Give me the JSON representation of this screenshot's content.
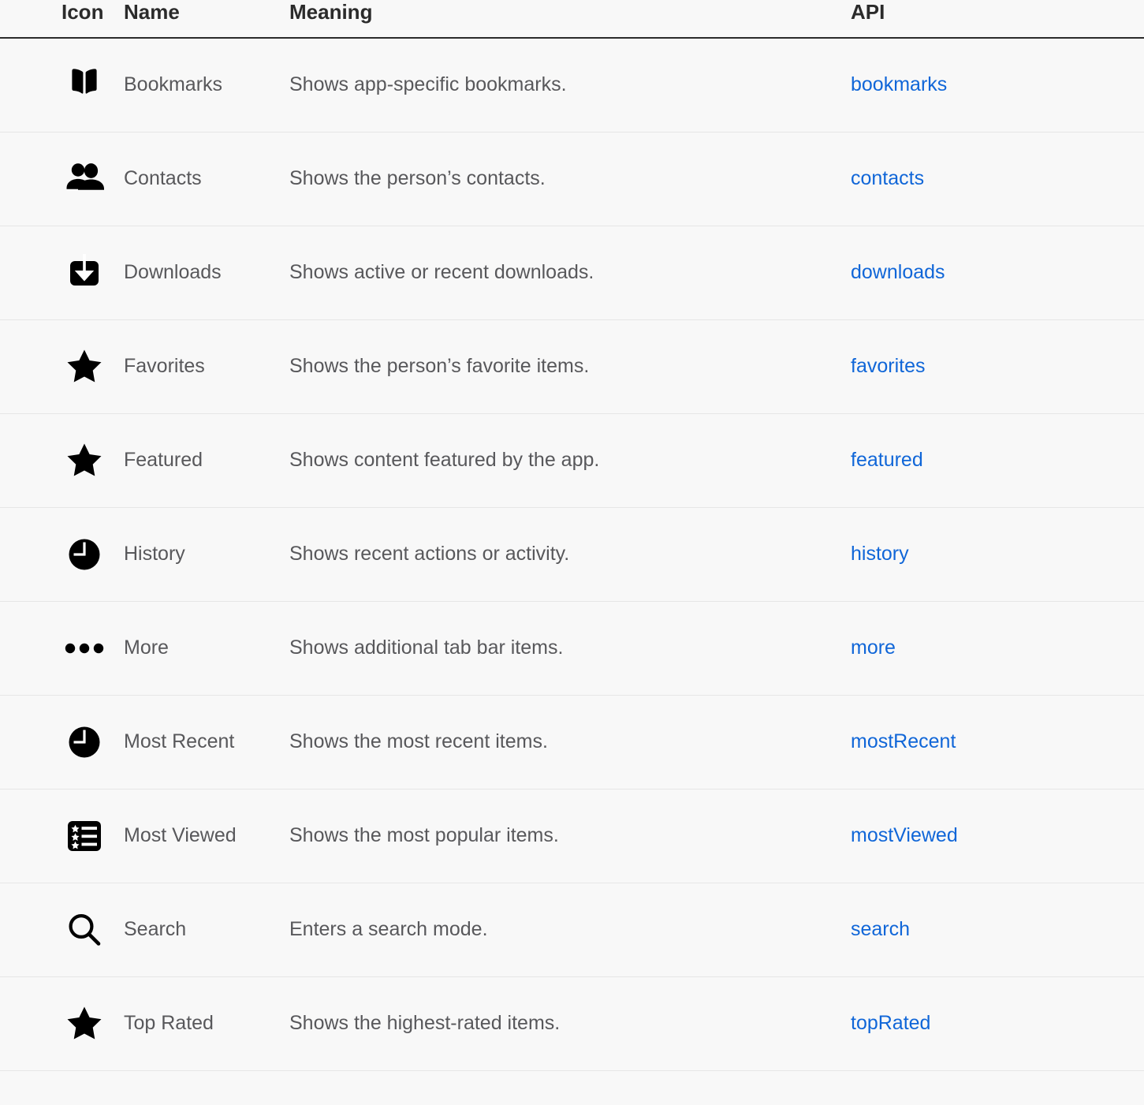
{
  "table": {
    "headers": {
      "icon": "Icon",
      "name": "Name",
      "meaning": "Meaning",
      "api": "API"
    },
    "colors": {
      "background": "#f8f8f8",
      "header_text": "#2b2b2b",
      "body_text": "#58585b",
      "link": "#1066d8",
      "divider": "#e6e6e6",
      "header_rule": "#2b2b2b",
      "icon": "#000000"
    },
    "rows": [
      {
        "icon": "open-book-icon",
        "name": "Bookmarks",
        "meaning": "Shows app-specific bookmarks.",
        "api": "bookmarks"
      },
      {
        "icon": "two-people-icon",
        "name": "Contacts",
        "meaning": "Shows the person’s contacts.",
        "api": "contacts"
      },
      {
        "icon": "download-arrow-square-icon",
        "name": "Downloads",
        "meaning": "Shows active or recent downloads.",
        "api": "downloads"
      },
      {
        "icon": "star-icon",
        "name": "Favorites",
        "meaning": "Shows the person’s favorite items.",
        "api": "favorites"
      },
      {
        "icon": "star-icon",
        "name": "Featured",
        "meaning": "Shows content featured by the app.",
        "api": "featured"
      },
      {
        "icon": "clock-icon",
        "name": "History",
        "meaning": "Shows recent actions or activity.",
        "api": "history"
      },
      {
        "icon": "ellipsis-icon",
        "name": "More",
        "meaning": "Shows additional tab bar items.",
        "api": "more"
      },
      {
        "icon": "clock-icon",
        "name": "Most Recent",
        "meaning": "Shows the most recent items.",
        "api": "mostRecent"
      },
      {
        "icon": "starred-list-square-icon",
        "name": "Most Viewed",
        "meaning": "Shows the most popular items.",
        "api": "mostViewed"
      },
      {
        "icon": "magnifying-glass-icon",
        "name": "Search",
        "meaning": "Enters a search mode.",
        "api": "search"
      },
      {
        "icon": "star-icon",
        "name": "Top Rated",
        "meaning": "Shows the highest-rated items.",
        "api": "topRated"
      }
    ]
  }
}
